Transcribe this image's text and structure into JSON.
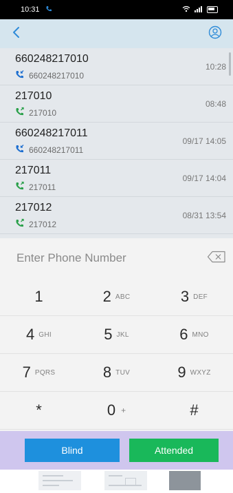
{
  "status_bar": {
    "time": "10:31",
    "notification_icon": "phone-notification-icon",
    "right_icons": [
      "wifi-icon",
      "signal-icon",
      "battery-icon"
    ]
  },
  "header": {
    "back_icon": "chevron-left-icon",
    "profile_icon": "person-circle-icon"
  },
  "calls": [
    {
      "name": "660248217010",
      "number": "660248217010",
      "time": "10:28",
      "direction": "incoming",
      "icon_color": "#1e6fd0"
    },
    {
      "name": "217010",
      "number": "217010",
      "time": "08:48",
      "direction": "outgoing",
      "icon_color": "#2aa04a"
    },
    {
      "name": "660248217011",
      "number": "660248217011",
      "time": "09/17 14:05",
      "direction": "incoming",
      "icon_color": "#1e6fd0"
    },
    {
      "name": "217011",
      "number": "217011",
      "time": "09/17 14:04",
      "direction": "outgoing",
      "icon_color": "#2aa04a"
    },
    {
      "name": "217012",
      "number": "217012",
      "time": "08/31 13:54",
      "direction": "outgoing",
      "icon_color": "#2aa04a"
    }
  ],
  "dialer": {
    "placeholder": "Enter Phone Number",
    "value": "",
    "backspace_icon": "backspace-icon"
  },
  "keypad": {
    "rows": [
      [
        {
          "digit": "1",
          "letters": ""
        },
        {
          "digit": "2",
          "letters": "ABC"
        },
        {
          "digit": "3",
          "letters": "DEF"
        }
      ],
      [
        {
          "digit": "4",
          "letters": "GHI"
        },
        {
          "digit": "5",
          "letters": "JKL"
        },
        {
          "digit": "6",
          "letters": "MNO"
        }
      ],
      [
        {
          "digit": "7",
          "letters": "PQRS"
        },
        {
          "digit": "8",
          "letters": "TUV"
        },
        {
          "digit": "9",
          "letters": "WXYZ"
        }
      ],
      [
        {
          "digit": "*",
          "letters": ""
        },
        {
          "digit": "0",
          "letters": "+"
        },
        {
          "digit": "#",
          "letters": ""
        }
      ]
    ]
  },
  "transfer": {
    "blind_label": "Blind",
    "attended_label": "Attended"
  },
  "colors": {
    "header_bg": "#d5e5ee",
    "accent": "#2e8bd8",
    "blind_button": "#1e90dd",
    "attended_button": "#19b85a",
    "transfer_bar": "#cfc6ee"
  }
}
